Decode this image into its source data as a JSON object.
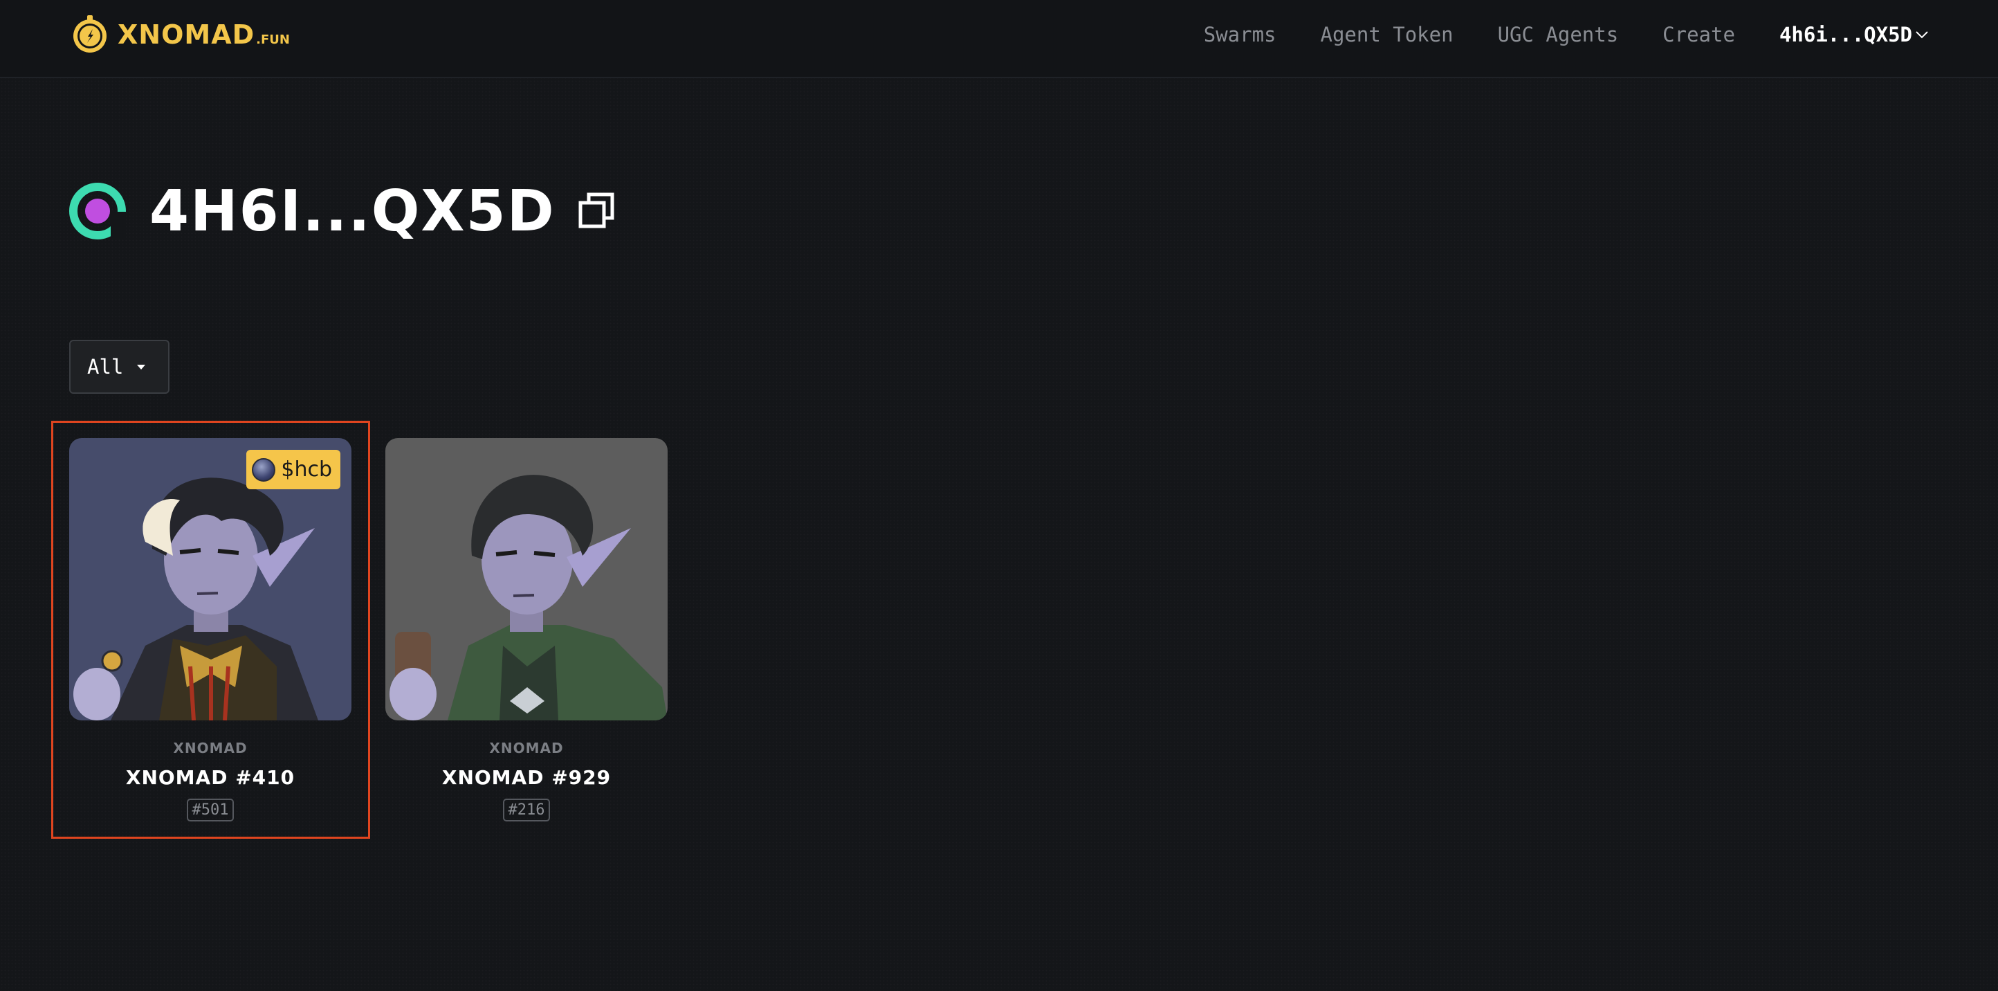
{
  "header": {
    "logo_text": "XNOMAD",
    "logo_suffix": ".FUN",
    "nav": [
      "Swarms",
      "Agent Token",
      "UGC Agents",
      "Create"
    ],
    "wallet_label": "4h6i...QX5D"
  },
  "profile": {
    "name": "4H6I...QX5D"
  },
  "filter": {
    "selected": "All"
  },
  "cards": [
    {
      "collection": "XNOMAD",
      "title": "XNOMAD #410",
      "rank": "#501",
      "token": "$hcb",
      "selected": true
    },
    {
      "collection": "XNOMAD",
      "title": "XNOMAD #929",
      "rank": "#216"
    }
  ],
  "colors": {
    "accent": "#f3c64a",
    "selection": "#e0451f",
    "background": "#141619"
  }
}
